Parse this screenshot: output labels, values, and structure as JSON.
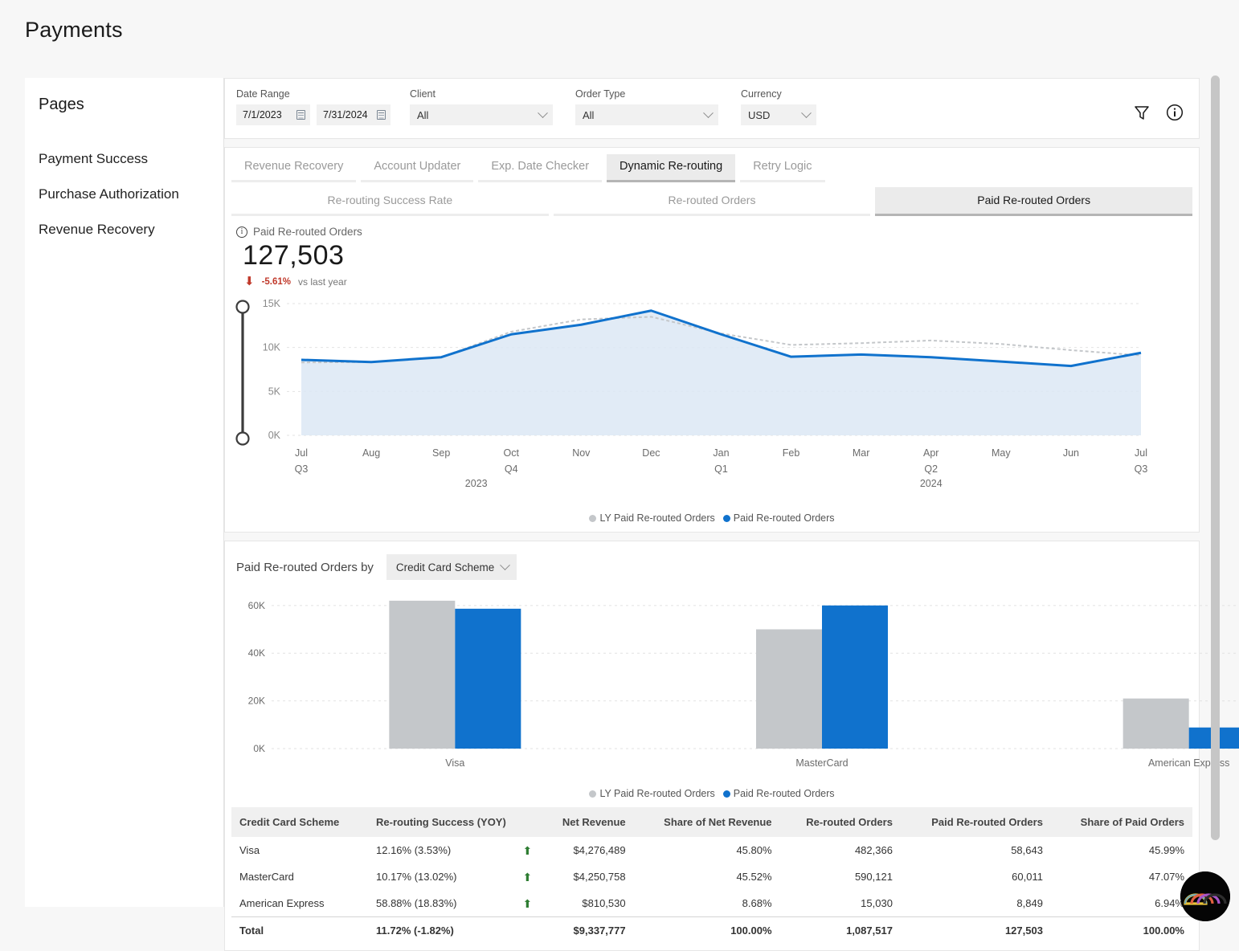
{
  "app": {
    "title": "Payments"
  },
  "sidebar": {
    "heading": "Pages",
    "items": [
      {
        "label": "Payment Success"
      },
      {
        "label": "Purchase Authorization"
      },
      {
        "label": "Revenue Recovery"
      }
    ]
  },
  "filters": {
    "date_range": {
      "label": "Date Range",
      "start": "7/1/2023",
      "end": "7/31/2024"
    },
    "client": {
      "label": "Client",
      "value": "All"
    },
    "order_type": {
      "label": "Order Type",
      "value": "All"
    },
    "currency": {
      "label": "Currency",
      "value": "USD"
    },
    "filter_icon": "filter-funnel-icon",
    "info_icon": "info-icon"
  },
  "tabs": [
    {
      "label": "Revenue Recovery",
      "active": false
    },
    {
      "label": "Account Updater",
      "active": false
    },
    {
      "label": "Exp. Date Checker",
      "active": false
    },
    {
      "label": "Dynamic Re-routing",
      "active": true
    },
    {
      "label": "Retry Logic",
      "active": false
    }
  ],
  "subtabs": [
    {
      "label": "Re-routing Success Rate",
      "active": false
    },
    {
      "label": "Re-routed Orders",
      "active": false
    },
    {
      "label": "Paid Re-routed Orders",
      "active": true
    }
  ],
  "kpi": {
    "label": "Paid Re-routed Orders",
    "value": "127,503",
    "delta": "-5.61%",
    "delta_direction": "down",
    "comparison": "vs last year",
    "negative_color": "#c0392b"
  },
  "bar_section": {
    "label": "Paid Re-routed Orders by",
    "dimension": "Credit Card Scheme"
  },
  "table": {
    "columns": [
      "Credit Card Scheme",
      "Re-routing Success (YOY)",
      "Net Revenue",
      "Share of Net Revenue",
      "Re-routed Orders",
      "Paid Re-routed Orders",
      "Share of Paid Orders"
    ],
    "rows": [
      {
        "scheme": "Visa",
        "rerouting_success": "12.16% (3.53%)",
        "trend": "up",
        "net_revenue": "$4,276,489",
        "share_net_revenue": "45.80%",
        "rerouted_orders": "482,366",
        "paid_rerouted_orders": "58,643",
        "share_paid_orders": "45.99%"
      },
      {
        "scheme": "MasterCard",
        "rerouting_success": "10.17% (13.02%)",
        "trend": "up",
        "net_revenue": "$4,250,758",
        "share_net_revenue": "45.52%",
        "rerouted_orders": "590,121",
        "paid_rerouted_orders": "60,011",
        "share_paid_orders": "47.07%"
      },
      {
        "scheme": "American Express",
        "rerouting_success": "58.88% (18.83%)",
        "trend": "up",
        "net_revenue": "$810,530",
        "share_net_revenue": "8.68%",
        "rerouted_orders": "15,030",
        "paid_rerouted_orders": "8,849",
        "share_paid_orders": "6.94%"
      }
    ],
    "total": {
      "scheme": "Total",
      "rerouting_success": "11.72% (-1.82%)",
      "trend": "none",
      "net_revenue": "$9,337,777",
      "share_net_revenue": "100.00%",
      "rerouted_orders": "1,087,517",
      "paid_rerouted_orders": "127,503",
      "share_paid_orders": "100.00%"
    }
  },
  "colors": {
    "series_current": "#1072cd",
    "series_last_year": "#c4c7ca",
    "area_fill": "#dce8f5",
    "up_trend": "#2e7d32",
    "down_trend": "#c0392b"
  },
  "chart_data": [
    {
      "type": "line",
      "title": "Paid Re-routed Orders",
      "xlabel": "",
      "ylabel": "",
      "ylim": [
        0,
        15000
      ],
      "yticks": [
        "0K",
        "5K",
        "10K",
        "15K"
      ],
      "grid": true,
      "legend_position": "bottom",
      "categories": [
        "Jul",
        "Aug",
        "Sep",
        "Oct",
        "Nov",
        "Dec",
        "Jan",
        "Feb",
        "Mar",
        "Apr",
        "May",
        "Jun",
        "Jul"
      ],
      "quarter_labels": [
        "Q3",
        "",
        "",
        "Q4",
        "",
        "",
        "Q1",
        "",
        "",
        "Q2",
        "",
        "",
        "Q3"
      ],
      "year_labels": {
        "2023": "2023",
        "2024": "2024"
      },
      "series": [
        {
          "name": "LY Paid Re-routed Orders",
          "color": "#c4c7ca",
          "style": "dashed",
          "values": [
            8300,
            8350,
            8900,
            11800,
            13200,
            13500,
            11600,
            10300,
            10500,
            10800,
            10400,
            9700,
            9100
          ]
        },
        {
          "name": "Paid Re-routed Orders",
          "color": "#1072cd",
          "style": "solid",
          "values": [
            8600,
            8350,
            8900,
            11500,
            12600,
            14200,
            11500,
            8950,
            9200,
            8900,
            8400,
            7900,
            9400
          ]
        }
      ]
    },
    {
      "type": "bar",
      "title": "Paid Re-routed Orders by Credit Card Scheme",
      "xlabel": "",
      "ylabel": "",
      "ylim": [
        0,
        66000
      ],
      "yticks": [
        "0K",
        "20K",
        "40K",
        "60K"
      ],
      "grid": true,
      "legend_position": "bottom",
      "categories": [
        "Visa",
        "MasterCard",
        "American Express"
      ],
      "series": [
        {
          "name": "LY Paid Re-routed Orders",
          "color": "#c4c7ca",
          "values": [
            62000,
            50000,
            21000
          ]
        },
        {
          "name": "Paid Re-routed Orders",
          "color": "#1072cd",
          "values": [
            58643,
            60011,
            8849
          ]
        }
      ]
    }
  ]
}
